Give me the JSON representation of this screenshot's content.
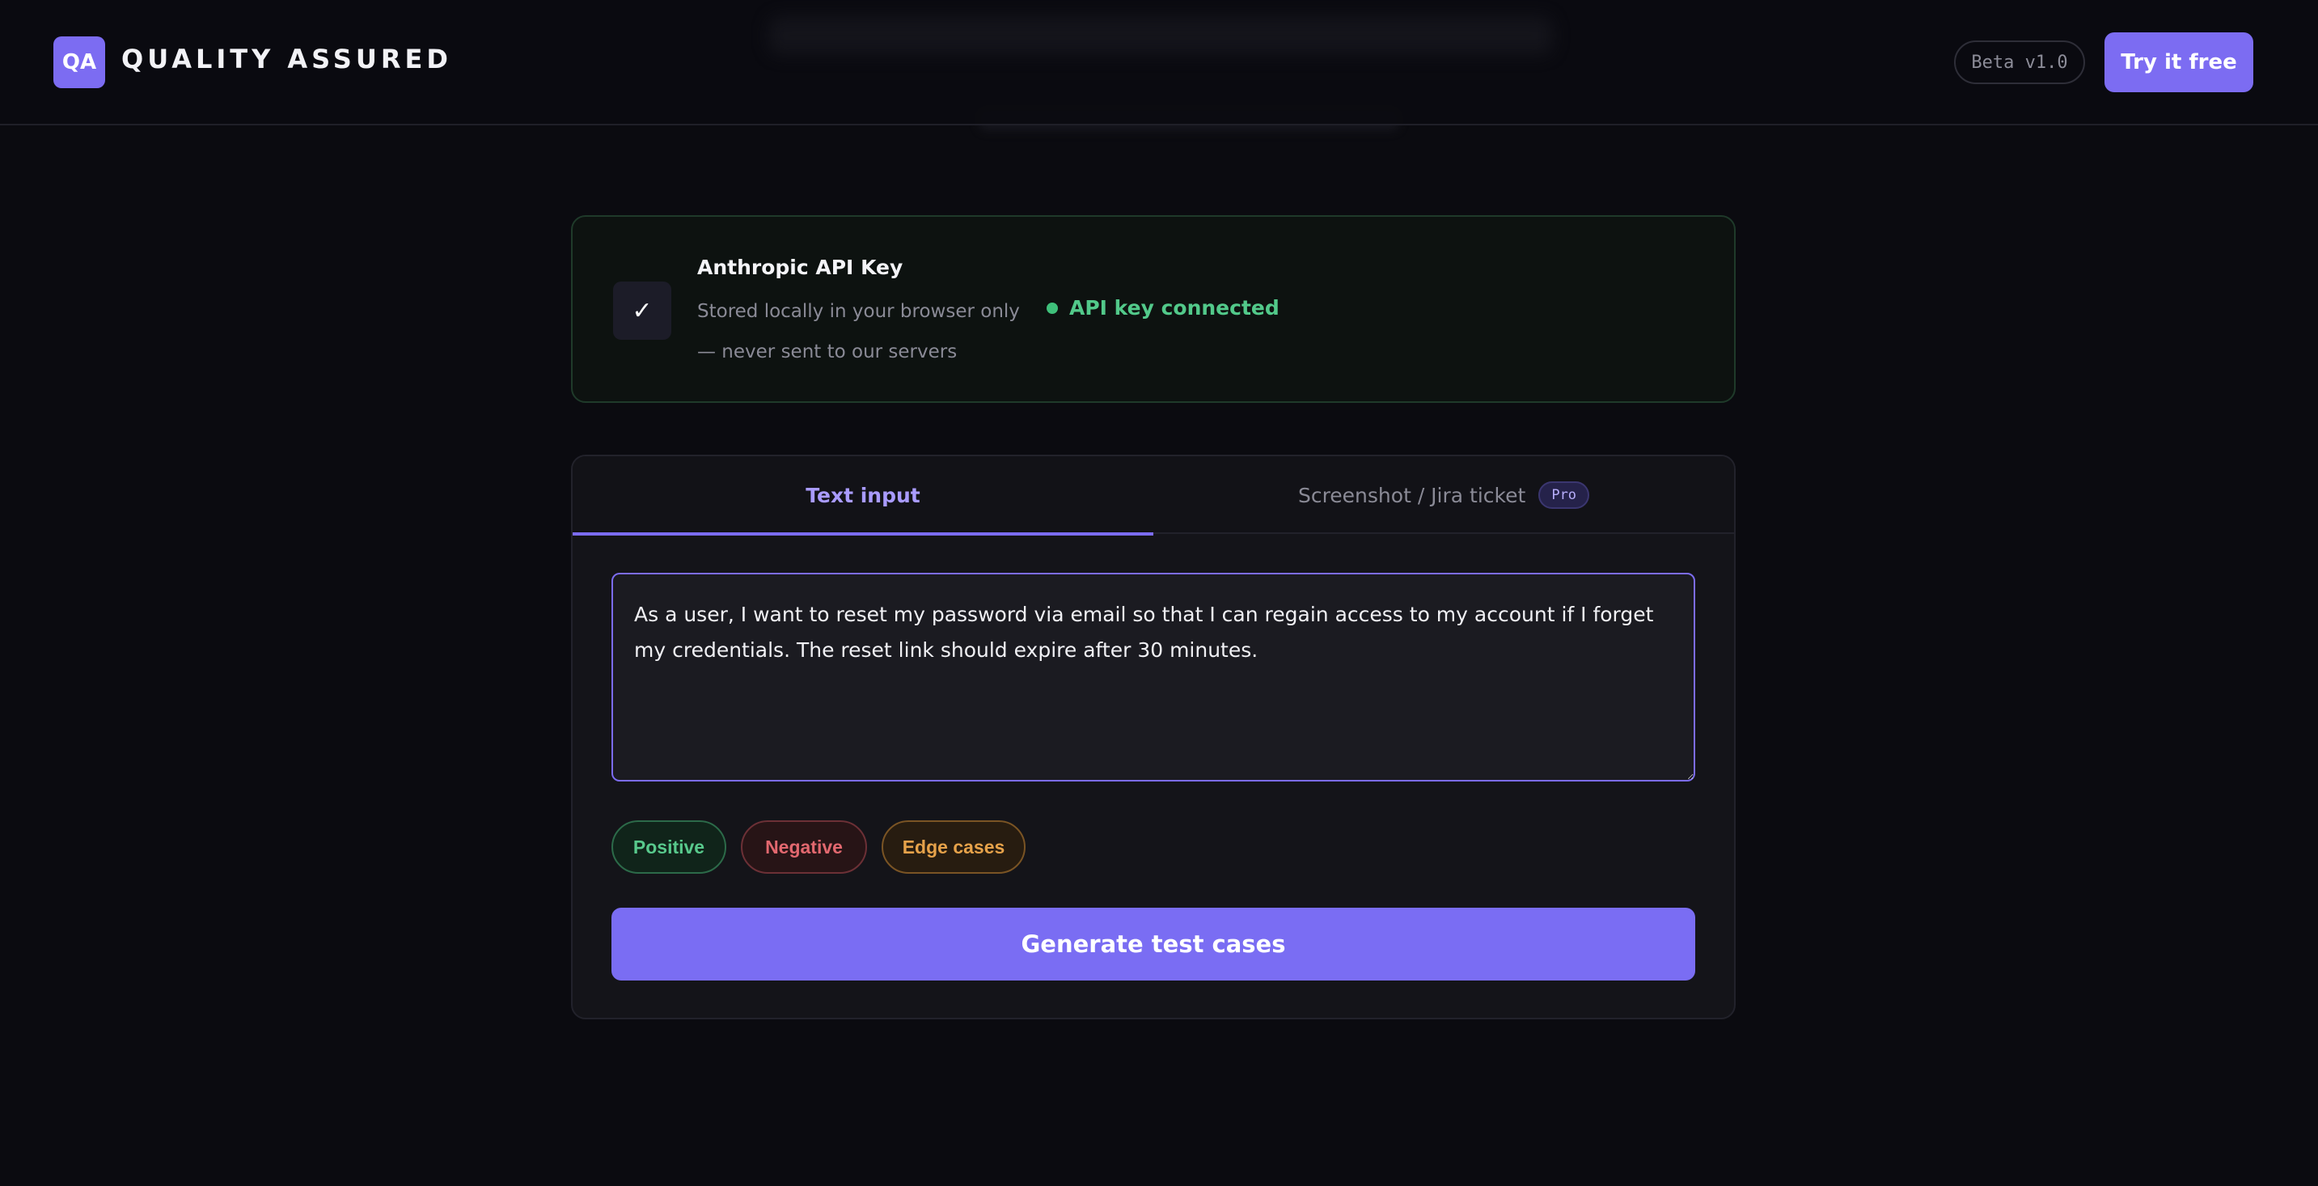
{
  "header": {
    "logo_text": "QA",
    "brand": "QUALITY ASSURED",
    "beta_label": "Beta v1.0",
    "cta_label": "Try it free"
  },
  "api_key": {
    "icon": "check-icon",
    "icon_glyph": "✓",
    "title": "Anthropic API Key",
    "description": "Stored locally in your browser only — never sent to our servers",
    "status": "API key connected"
  },
  "tabs": [
    {
      "label": "Text input",
      "active": true
    },
    {
      "label": "Screenshot / Jira ticket",
      "badge": "Pro",
      "active": false
    }
  ],
  "story_input": {
    "value": "As a user, I want to reset my password via email so that I can regain access to my account if I forget my credentials. The reset link should expire after 30 minutes."
  },
  "filters": [
    {
      "label": "Positive"
    },
    {
      "label": "Negative"
    },
    {
      "label": "Edge cases"
    }
  ],
  "generate_label": "Generate test cases",
  "colors": {
    "accent": "#7c6cf2",
    "success": "#52c98a",
    "positive": "#58c98c",
    "negative": "#e2686f",
    "edge": "#e6a24a",
    "background": "#0b0b10"
  }
}
